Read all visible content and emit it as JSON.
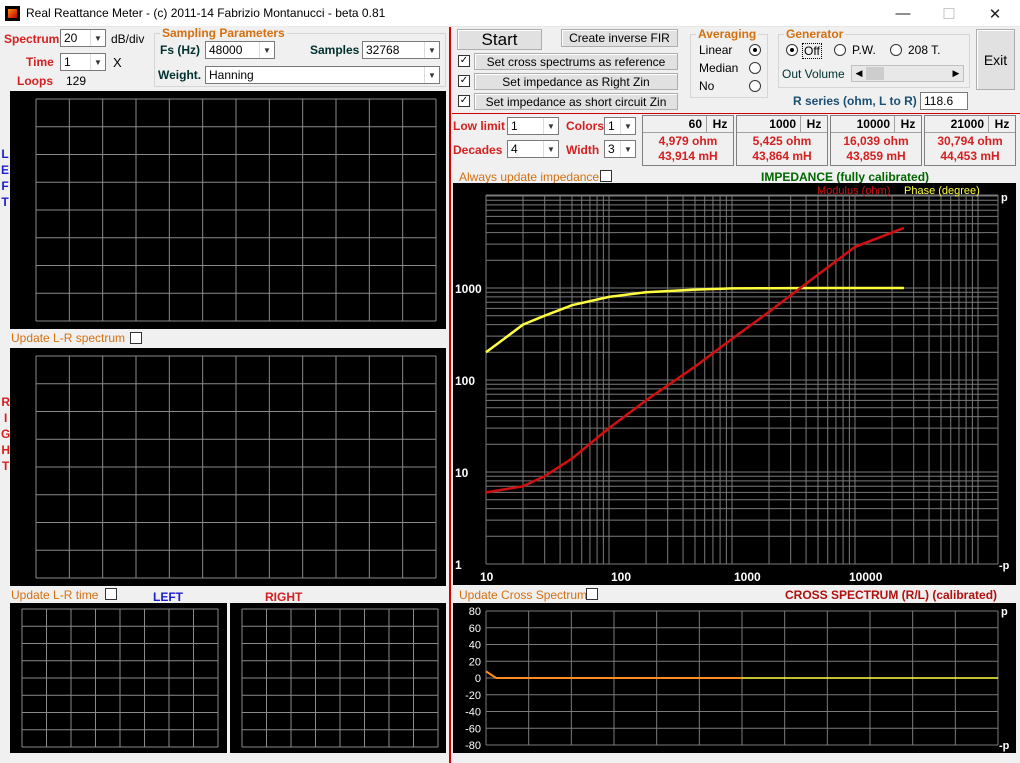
{
  "window": {
    "title": "Real Reattance Meter - (c) 2011-14 Fabrizio Montanucci - beta 0.81",
    "minimize": "—",
    "maximize": "☐",
    "close": "✕"
  },
  "left_controls": {
    "spectrum_label": "Spectrum",
    "spectrum_value": "20",
    "spectrum_unit": "dB/div",
    "time_label": "Time",
    "time_value": "1",
    "time_unit": "X",
    "loops_label": "Loops",
    "loops_value": "129"
  },
  "sampling": {
    "group_title": "Sampling Parameters",
    "fs_label": "Fs (Hz)",
    "fs_value": "48000",
    "samples_label": "Samples",
    "samples_value": "32768",
    "weight_label": "Weight.",
    "weight_value": "Hanning"
  },
  "left_panel": {
    "left_vertical": [
      "L",
      "E",
      "F",
      "T"
    ],
    "right_vertical": [
      "R",
      "I",
      "G",
      "H",
      "T"
    ],
    "update_lr_spectrum": "Update L-R spectrum",
    "update_lr_time": "Update L-R time",
    "left_label": "LEFT",
    "right_label": "RIGHT"
  },
  "actions": {
    "start": "Start",
    "create_fir": "Create inverse FIR",
    "cross_ref": "Set cross spectrums as reference",
    "imp_right": "Set impedance as Right Zin",
    "imp_short": "Set impedance as short circuit Zin",
    "exit": "Exit"
  },
  "averaging": {
    "title": "Averaging",
    "options": [
      "Linear",
      "Median",
      "No"
    ],
    "selected": "Linear"
  },
  "generator": {
    "title": "Generator",
    "options": [
      "Off",
      "P.W.",
      "208 T."
    ],
    "selected": "Off",
    "out_volume_label": "Out Volume"
  },
  "rseries": {
    "label": "R series (ohm, L to R)",
    "value": "118.6"
  },
  "limits": {
    "low_limit_label": "Low limit",
    "low_limit_value": "1",
    "decades_label": "Decades",
    "decades_value": "4",
    "colors_label": "Colors",
    "colors_value": "1",
    "width_label": "Width",
    "width_value": "3"
  },
  "freq_readouts": [
    {
      "freq": "60",
      "unit": "Hz",
      "ohm": "4,979 ohm",
      "mh": "43,914 mH"
    },
    {
      "freq": "1000",
      "unit": "Hz",
      "ohm": "5,425 ohm",
      "mh": "43,864 mH"
    },
    {
      "freq": "10000",
      "unit": "Hz",
      "ohm": "16,039 ohm",
      "mh": "43,859 mH"
    },
    {
      "freq": "21000",
      "unit": "Hz",
      "ohm": "30,794 ohm",
      "mh": "44,453 mH"
    }
  ],
  "impedance_plot": {
    "always_update": "Always update impedance",
    "title": "IMPEDANCE (fully calibrated)",
    "legend_modulus": "Modulus (ohm)",
    "legend_phase": "Phase (degree)",
    "y_ticks": [
      "1000",
      "100",
      "10",
      "1"
    ],
    "x_ticks": [
      "10",
      "100",
      "1000",
      "10000"
    ],
    "right_top": "p",
    "right_bottom": "-p"
  },
  "cross_plot": {
    "update_label": "Update Cross Spectrum",
    "title": "CROSS SPECTRUM (R/L) (calibrated)",
    "y_ticks": [
      "80",
      "60",
      "40",
      "20",
      "0",
      "-20",
      "-40",
      "-60",
      "-80"
    ],
    "right_top": "p",
    "right_bottom": "-p"
  },
  "colors": {
    "accent_red": "#d42020",
    "accent_blue": "#1d1dcf",
    "impedance_title": "#006600",
    "modulus_trace": "#d01010",
    "phase_trace": "#ffff40",
    "grid": "#808080"
  },
  "chart_data": [
    {
      "type": "line",
      "title": "IMPEDANCE (fully calibrated)",
      "x_scale": "log",
      "y_scale": "log",
      "xlim": [
        5,
        40000
      ],
      "ylim": [
        1,
        5000
      ],
      "grid": true,
      "legend": "top-right",
      "series": [
        {
          "name": "Modulus (ohm)",
          "x": [
            10,
            20,
            30,
            50,
            100,
            200,
            500,
            1000,
            2000,
            5000,
            10000,
            20000,
            25000
          ],
          "y": [
            6,
            7,
            9,
            14,
            30,
            60,
            140,
            280,
            550,
            1400,
            2800,
            4000,
            4500
          ]
        },
        {
          "name": "Phase (degree)",
          "x": [
            10,
            15,
            20,
            30,
            50,
            100,
            200,
            500,
            1000,
            2000,
            5000,
            10000,
            25000
          ],
          "y": [
            200,
            300,
            400,
            500,
            650,
            800,
            900,
            960,
            990,
            995,
            1000,
            1000,
            1000
          ]
        }
      ]
    },
    {
      "type": "line",
      "title": "CROSS SPECTRUM (R/L) (calibrated)",
      "ylim": [
        -80,
        80
      ],
      "yticks": [
        80,
        60,
        40,
        20,
        0,
        -20,
        -40,
        -60,
        -80
      ],
      "grid": true,
      "series": [
        {
          "name": "",
          "x": [
            0,
            0.02,
            0.5,
            1
          ],
          "y": [
            8,
            0,
            0,
            0
          ]
        }
      ]
    }
  ]
}
